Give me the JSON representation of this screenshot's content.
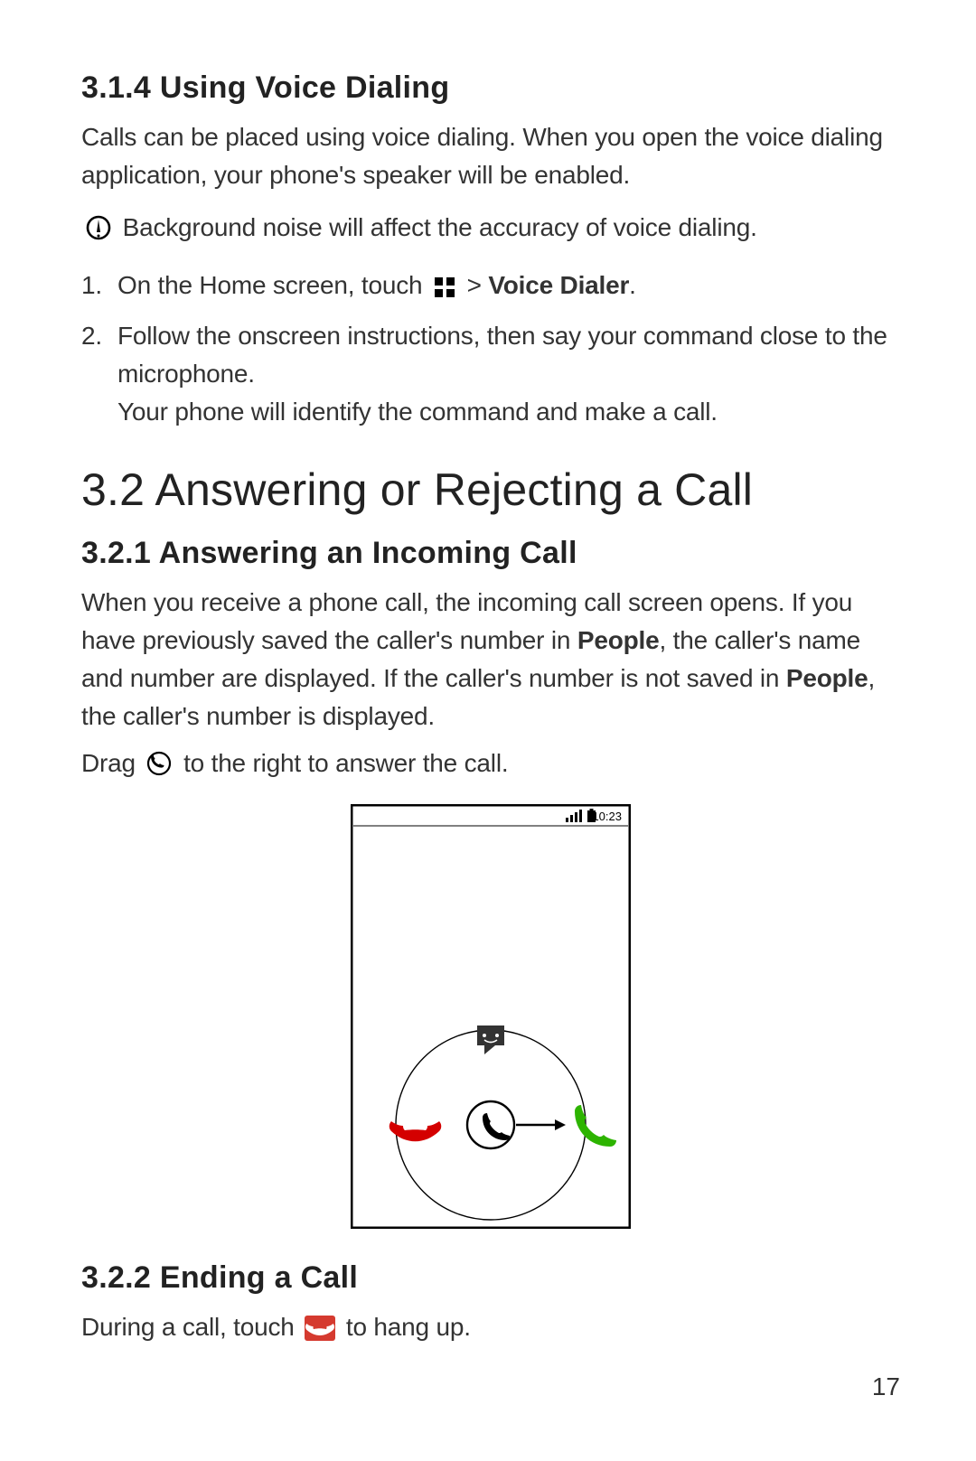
{
  "section_314": {
    "heading": "3.1.4  Using Voice Dialing",
    "p1": "Calls can be placed using voice dialing. When you open the voice dialing application, your phone's speaker will be enabled.",
    "note": "Background noise will affect the accuracy of voice dialing.",
    "step1_pre": "On the Home screen, touch",
    "step1_post": ">",
    "step1_bold": "Voice Dialer",
    "step1_end": ".",
    "step2_line1": "Follow the onscreen instructions, then say your command close to the microphone.",
    "step2_line2": "Your phone will identify the command and make a call."
  },
  "section_32": {
    "heading": "3.2  Answering or Rejecting a Call"
  },
  "section_321": {
    "heading": "3.2.1  Answering an Incoming Call",
    "p1a": "When you receive a phone call, the incoming call screen opens. If you have previously saved the caller's number in ",
    "p1_bold1": "People",
    "p1b": ", the caller's name and number are displayed. If the caller's number is not saved in ",
    "p1_bold2": "People",
    "p1c": ", the caller's number is displayed.",
    "drag_pre": "Drag",
    "drag_post": "to the right to answer the call.",
    "statusbar_time": "10:23"
  },
  "section_322": {
    "heading": "3.2.2  Ending a Call",
    "p1_pre": "During a call, touch",
    "p1_post": "to hang up."
  },
  "page_number": "17"
}
